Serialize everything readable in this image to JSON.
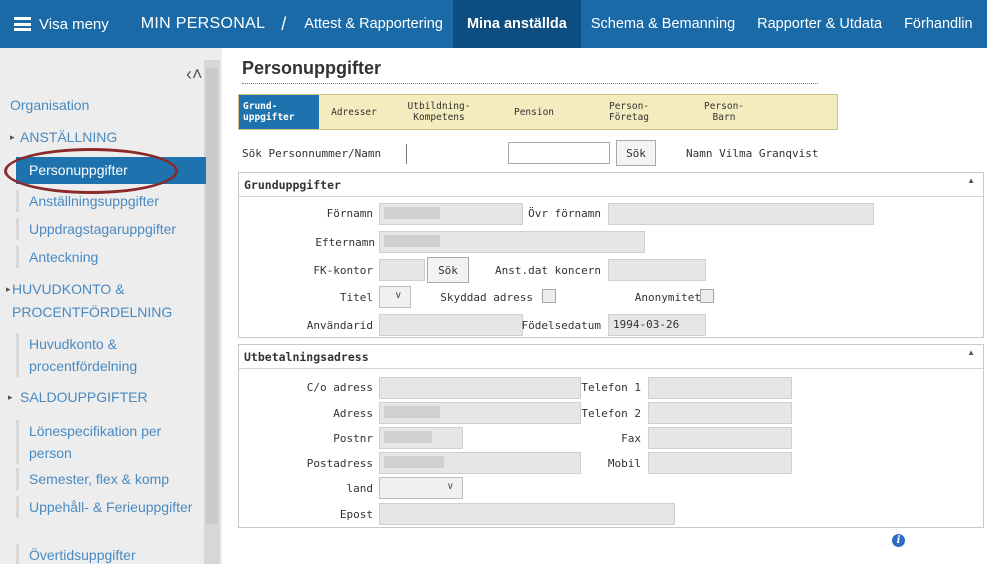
{
  "topnav": {
    "menu_label": "Visa meny",
    "brand": "MIN PERSONAL",
    "separator": "/",
    "items": [
      {
        "label": "Attest & Rapportering"
      },
      {
        "label": "Mina anställda"
      },
      {
        "label": "Schema & Bemanning"
      },
      {
        "label": "Rapporter & Utdata"
      },
      {
        "label": "Förhandlin"
      }
    ]
  },
  "sidebar": {
    "organisation": "Organisation",
    "sections": [
      {
        "label": "ANSTÄLLNING"
      },
      {
        "label": "HUVUDKONTO & PROCENTFÖRDELNING"
      },
      {
        "label": "SALDOUPPGIFTER"
      }
    ],
    "items": {
      "personuppgifter": "Personuppgifter",
      "anstallningsuppgifter": "Anställningsuppgifter",
      "uppdragstagaruppgifter": "Uppdragstagaruppgifter",
      "anteckning": "Anteckning",
      "huvudkonto": "Huvudkonto & procentfördelning",
      "lonespec": "Lönespecifikation per person",
      "semester": "Semester, flex & komp",
      "uppehall": "Uppehåll- & Ferieuppgifter",
      "overtid": "Övertidsuppgifter"
    }
  },
  "main": {
    "title": "Personuppgifter",
    "tabs": [
      {
        "line1": "Grund-",
        "line2": "uppgifter"
      },
      {
        "line1": "Adresser",
        "line2": ""
      },
      {
        "line1": "Utbildning-",
        "line2": "Kompetens"
      },
      {
        "line1": "Pension",
        "line2": ""
      },
      {
        "line1": "Person-",
        "line2": "Företag"
      },
      {
        "line1": "Person-",
        "line2": "Barn"
      }
    ],
    "search": {
      "label": "Sök Personnummer/Namn",
      "input_value": "",
      "button": "Sök",
      "name_label": "Namn Vilma Granqvist"
    },
    "grund": {
      "header": "Grunduppgifter",
      "fornamn": "Förnamn",
      "ovr_fornamn": "Övr förnamn",
      "efternamn": "Efternamn",
      "fk_kontor": "FK-kontor",
      "fk_sok": "Sök",
      "anst_dat": "Anst.dat koncern",
      "titel": "Titel",
      "skyddad": "Skyddad adress",
      "anonymitet": "Anonymitet",
      "anvandarid": "Användarid",
      "fodelsedatum": "Födelsedatum",
      "fodelsedatum_value": "1994-03-26"
    },
    "utbetalning": {
      "header": "Utbetalningsadress",
      "co_adress": "C/o adress",
      "telefon1": "Telefon 1",
      "adress": "Adress",
      "telefon2": "Telefon 2",
      "postnr": "Postnr",
      "fax": "Fax",
      "postadress": "Postadress",
      "mobil": "Mobil",
      "land": "land",
      "epost": "Epost"
    }
  },
  "colors": {
    "nav_bg": "#1a6aa8",
    "nav_active": "#0e4d80",
    "sidebar_active": "#1e72ae",
    "tab_bar": "#f4ebbf",
    "annotation_circle": "#8c2a2a"
  },
  "icons": [
    "hamburger-icon",
    "collapse-icon",
    "caret-down-icon",
    "collapse-up-icon",
    "chevron-down-icon",
    "info-icon"
  ]
}
